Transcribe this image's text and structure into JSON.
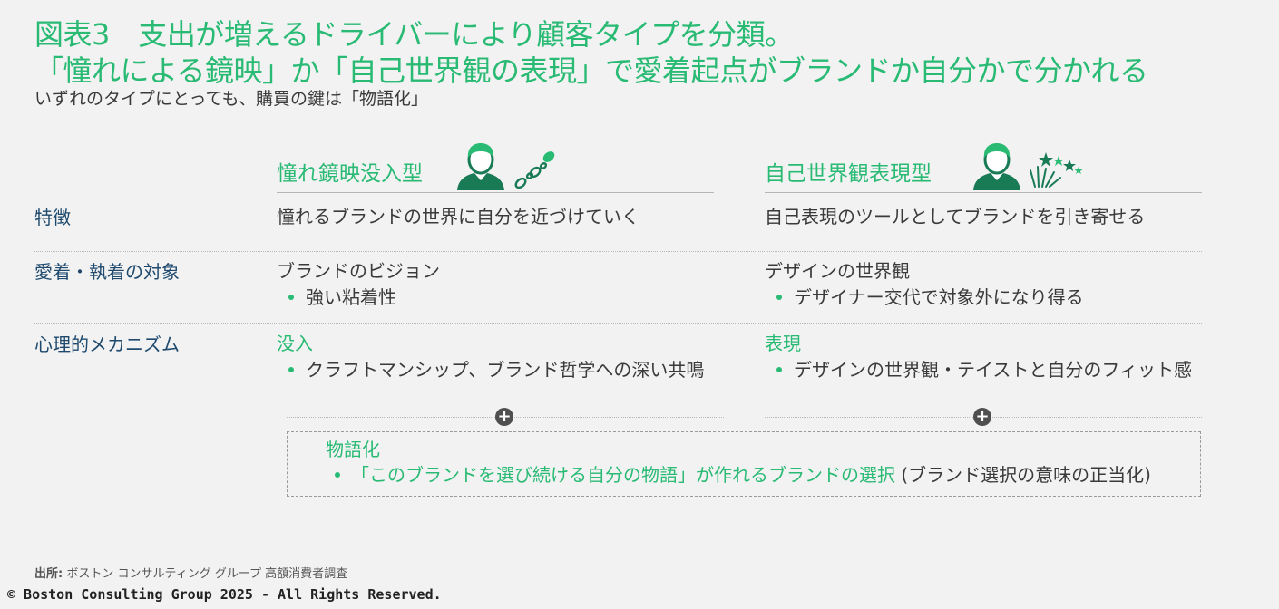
{
  "title": {
    "line1": "図表3　支出が増えるドライバーにより顧客タイプを分類。",
    "line2": "「憧れによる鏡映」か「自己世界観の表現」で愛着起点がブランドか自分かで分かれる"
  },
  "subtitle": "いずれのタイプにとっても、購買の鍵は「物語化」",
  "columns": [
    {
      "name": "憧れ鏡映没入型",
      "icons": [
        "person-icon",
        "footprints-icon"
      ]
    },
    {
      "name": "自己世界観表現型",
      "icons": [
        "person-icon",
        "fireworks-icon"
      ]
    }
  ],
  "rows": [
    {
      "label": "特徴",
      "left": {
        "text": "憧れるブランドの世界に自分を近づけていく"
      },
      "right": {
        "text": "自己表現のツールとしてブランドを引き寄せる"
      }
    },
    {
      "label": "愛着・執着の対象",
      "left": {
        "text": "ブランドのビジョン",
        "bullet": "強い粘着性"
      },
      "right": {
        "text": "デザインの世界観",
        "bullet": "デザイナー交代で対象外になり得る"
      }
    },
    {
      "label": "心理的メカニズム",
      "left": {
        "text": "没入",
        "bullet": "クラフトマンシップ、ブランド哲学への深い共鳴"
      },
      "right": {
        "text": "表現",
        "bullet": "デザインの世界観・テイストと自分のフィット感"
      }
    }
  ],
  "plus_symbol": "+",
  "story": {
    "heading": "物語化",
    "highlight": "「このブランドを選び続ける自分の物語」が作れるブランドの選択",
    "note": " (ブランド選択の意味の正当化)"
  },
  "source": {
    "label": "出所:",
    "text": " ボストン コンサルティング グループ 高額消費者調査"
  },
  "copyright": "© Boston Consulting Group 2025 - All Rights Reserved.",
  "colors": {
    "accent": "#29ba74",
    "dark_green": "#197a56",
    "label_blue": "#1f4a6e",
    "background": "#f2f2f2"
  }
}
